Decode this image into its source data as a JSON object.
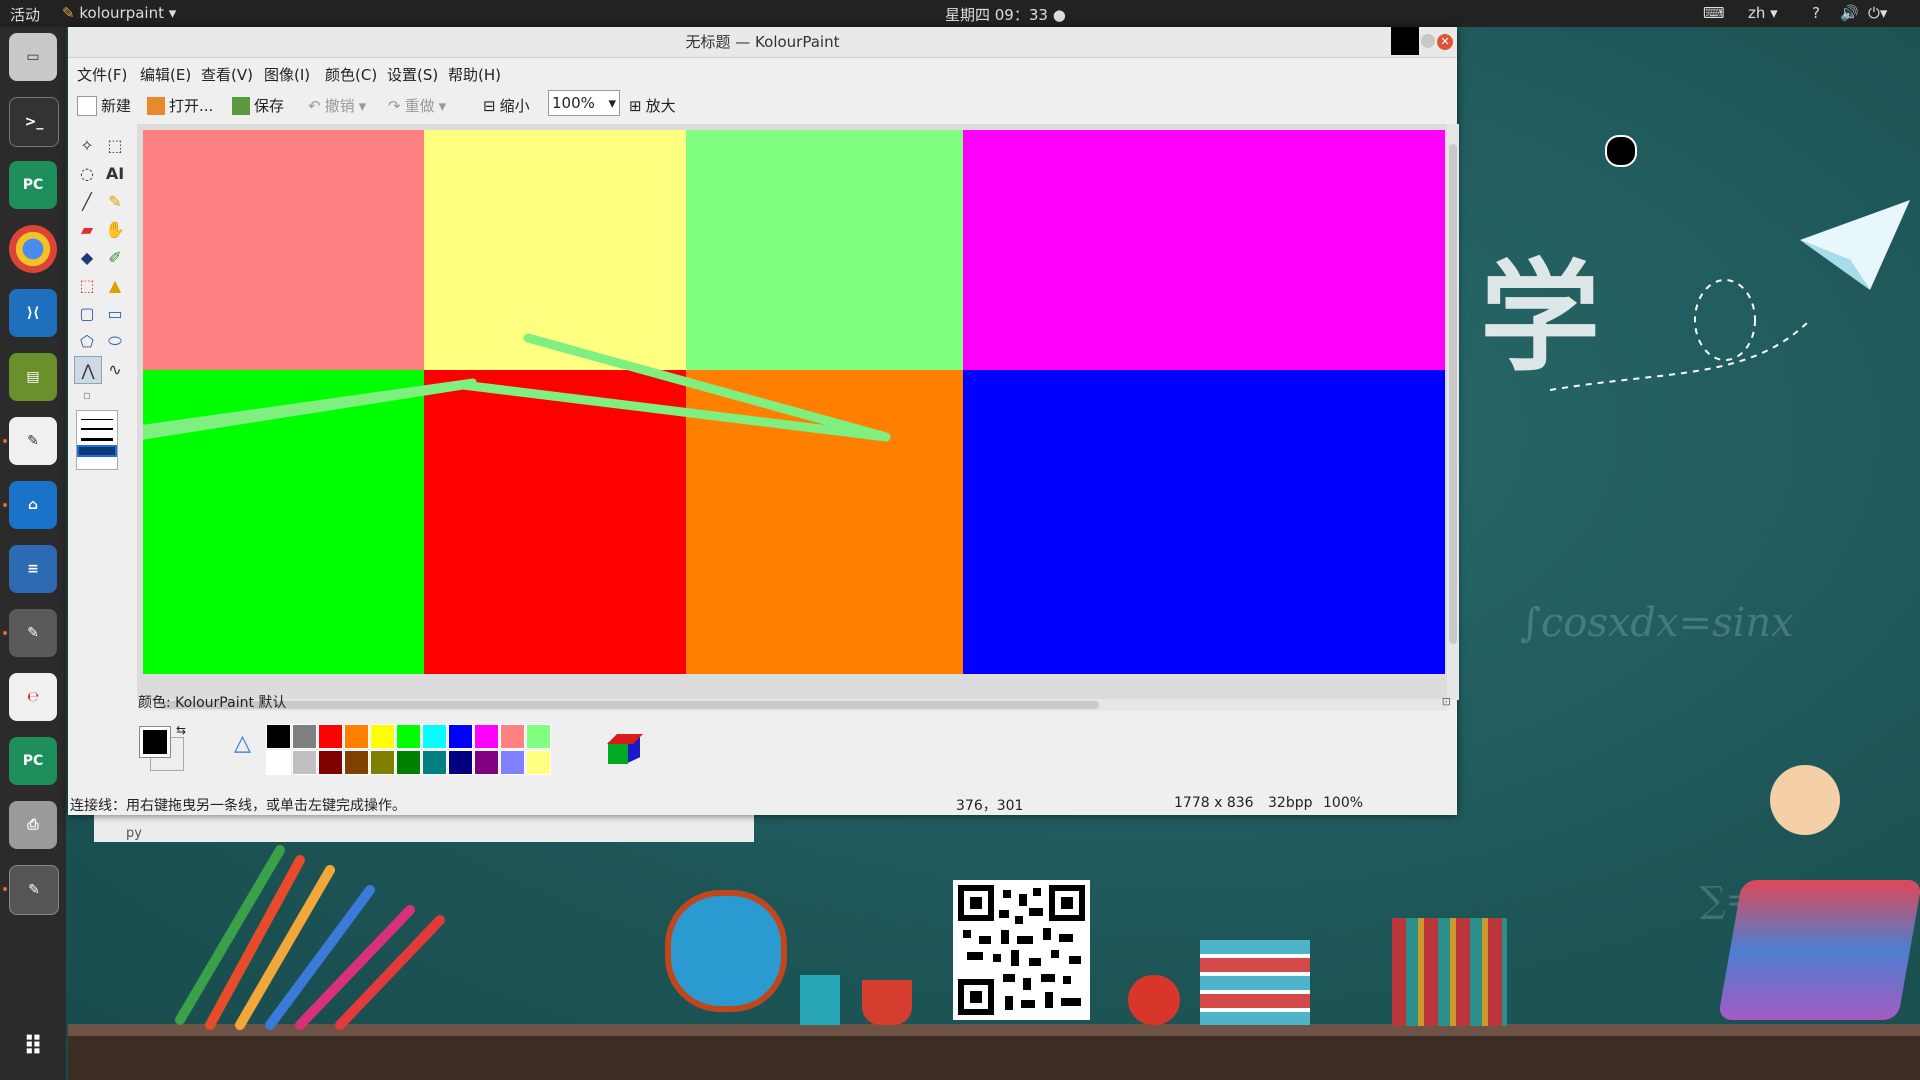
{
  "topbar": {
    "activities": "活动",
    "app_name": "kolourpaint",
    "clock": "星期四 09：33",
    "lang": "zh"
  },
  "window": {
    "title": "无标题 — KolourPaint"
  },
  "menu": [
    "文件(F)",
    "编辑(E)",
    "查看(V)",
    "图像(I)",
    "颜色(C)",
    "设置(S)",
    "帮助(H)"
  ],
  "toolbar": {
    "new": "新建",
    "open": "打开...",
    "save": "保存",
    "undo": "撤销",
    "redo": "重做",
    "zoom_out": "缩小",
    "zoom_value": "100%",
    "zoom_in": "放大"
  },
  "palette": {
    "label": "颜色:",
    "name": "KolourPaint 默认",
    "colors_top": [
      "#000000",
      "#808080",
      "#ff0000",
      "#ff8000",
      "#ffff00",
      "#00ff00",
      "#00ffff",
      "#0000ff",
      "#ff00ff",
      "#ff8080",
      "#80ff80"
    ],
    "colors_bottom": [
      "#ffffff",
      "#c0c0c0",
      "#800000",
      "#804000",
      "#808000",
      "#008000",
      "#008080",
      "#000080",
      "#800080",
      "#8080ff",
      "#ffff80"
    ]
  },
  "status": {
    "hint": "连接线：用右键拖曳另一条线，或单击左键完成操作。",
    "coords": "376，301",
    "size": "1778 x 836",
    "depth": "32bpp",
    "zoom": "100%"
  },
  "canvas_colors": {
    "r1": [
      "#ff8080",
      "#ffff80",
      "#80ff80",
      "#ff00ff"
    ],
    "r2": [
      "#00ff00",
      "#ff0000",
      "#ff8000",
      "#0000ff"
    ],
    "stroke": "#7ff080"
  },
  "desktop": {
    "snippet_label": "py"
  }
}
